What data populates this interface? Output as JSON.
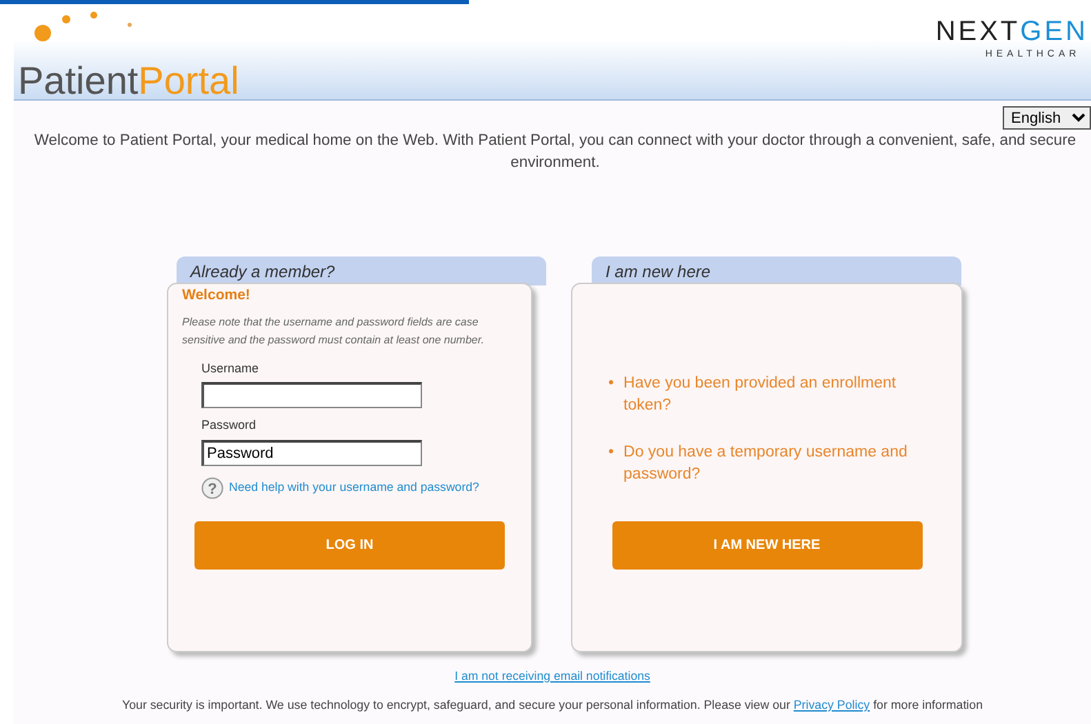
{
  "header": {
    "logo_main": "Patient",
    "logo_accent": "Portal",
    "brand_main": "NEXT",
    "brand_accent": "GEN",
    "brand_sub": "HEALTHCAR"
  },
  "language": {
    "value": "English"
  },
  "intro": "Welcome to Patient Portal, your medical home on the Web. With Patient Portal, you can connect with your doctor through a convenient, safe, and secure environment.",
  "member_panel": {
    "tab": "Already a member?",
    "heading": "Welcome!",
    "note": "Please note that the username and password fields are case sensitive and the password must contain at least one number.",
    "fields": [
      {
        "label": "Username"
      },
      {
        "label": "Password",
        "value": "Password"
      }
    ],
    "help_icon": "?",
    "help_link": "Need help with your username and password?",
    "button": "LOG IN"
  },
  "new_panel": {
    "tab": "I am new here",
    "bullet": "•",
    "questions": [
      "Have you been provided an enrollment token?",
      "Do you have a temporary username and password?"
    ],
    "button": "I AM NEW HERE"
  },
  "email_link": "I am not receiving email notifications",
  "footer": {
    "text": "Your security is important. We use technology to encrypt, safeguard, and secure your personal information. Please view our",
    "link": "Privacy Policy",
    "text_after": "for more information"
  }
}
